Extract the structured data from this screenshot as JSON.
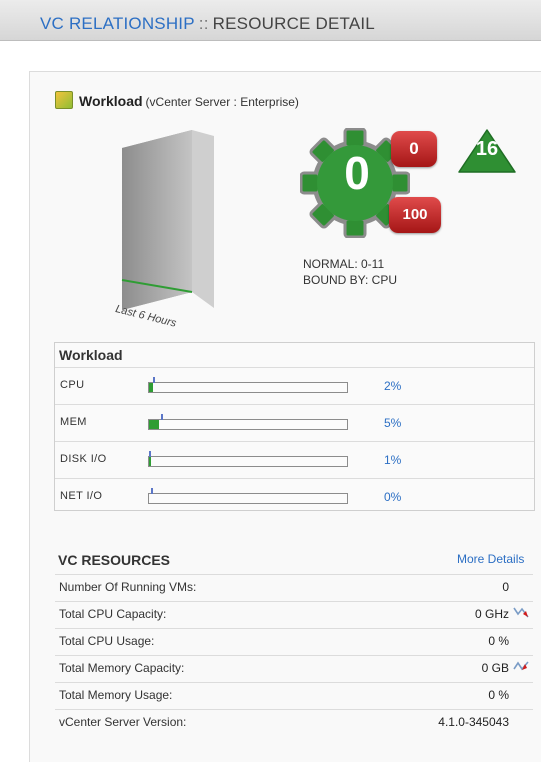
{
  "header": {
    "link": "VC RELATIONSHIP",
    "separator": "::",
    "title": "RESOURCE DETAIL"
  },
  "workload": {
    "title": "Workload",
    "subtitle": "(vCenter Server : Enterprise)",
    "time_label": "Last 6 Hours",
    "gear_value": "0",
    "badge_top": "0",
    "badge_bottom": "100",
    "triangle_value": "16",
    "normal": "NORMAL: 0-11",
    "bound": "BOUND BY: CPU"
  },
  "workload_box": {
    "title": "Workload",
    "rows": [
      {
        "label": "CPU",
        "pct": "2%",
        "value": 0.02
      },
      {
        "label": "MEM",
        "pct": "5%",
        "value": 0.05
      },
      {
        "label": "DISK I/O",
        "pct": "1%",
        "value": 0.01
      },
      {
        "label": "NET I/O",
        "pct": "0%",
        "value": 0.0
      }
    ]
  },
  "vc_resources": {
    "title": "VC RESOURCES",
    "more": "More Details",
    "rows": [
      {
        "key": "Number Of Running VMs:",
        "value": "0",
        "icon": ""
      },
      {
        "key": "Total CPU Capacity:",
        "value": "0 GHz",
        "icon": "trend-down-icon"
      },
      {
        "key": "Total CPU Usage:",
        "value": "0 %",
        "icon": ""
      },
      {
        "key": "Total Memory Capacity:",
        "value": "0 GB",
        "icon": "trend-mixed-icon"
      },
      {
        "key": "Total Memory Usage:",
        "value": "0 %",
        "icon": ""
      },
      {
        "key": "vCenter Server Version:",
        "value": "4.1.0-345043",
        "icon": ""
      }
    ]
  },
  "colors": {
    "link": "#2c6fc4",
    "bar_fill": "#2f9d34",
    "badge_red": "#c02020",
    "gear_green": "#2f8f33"
  }
}
